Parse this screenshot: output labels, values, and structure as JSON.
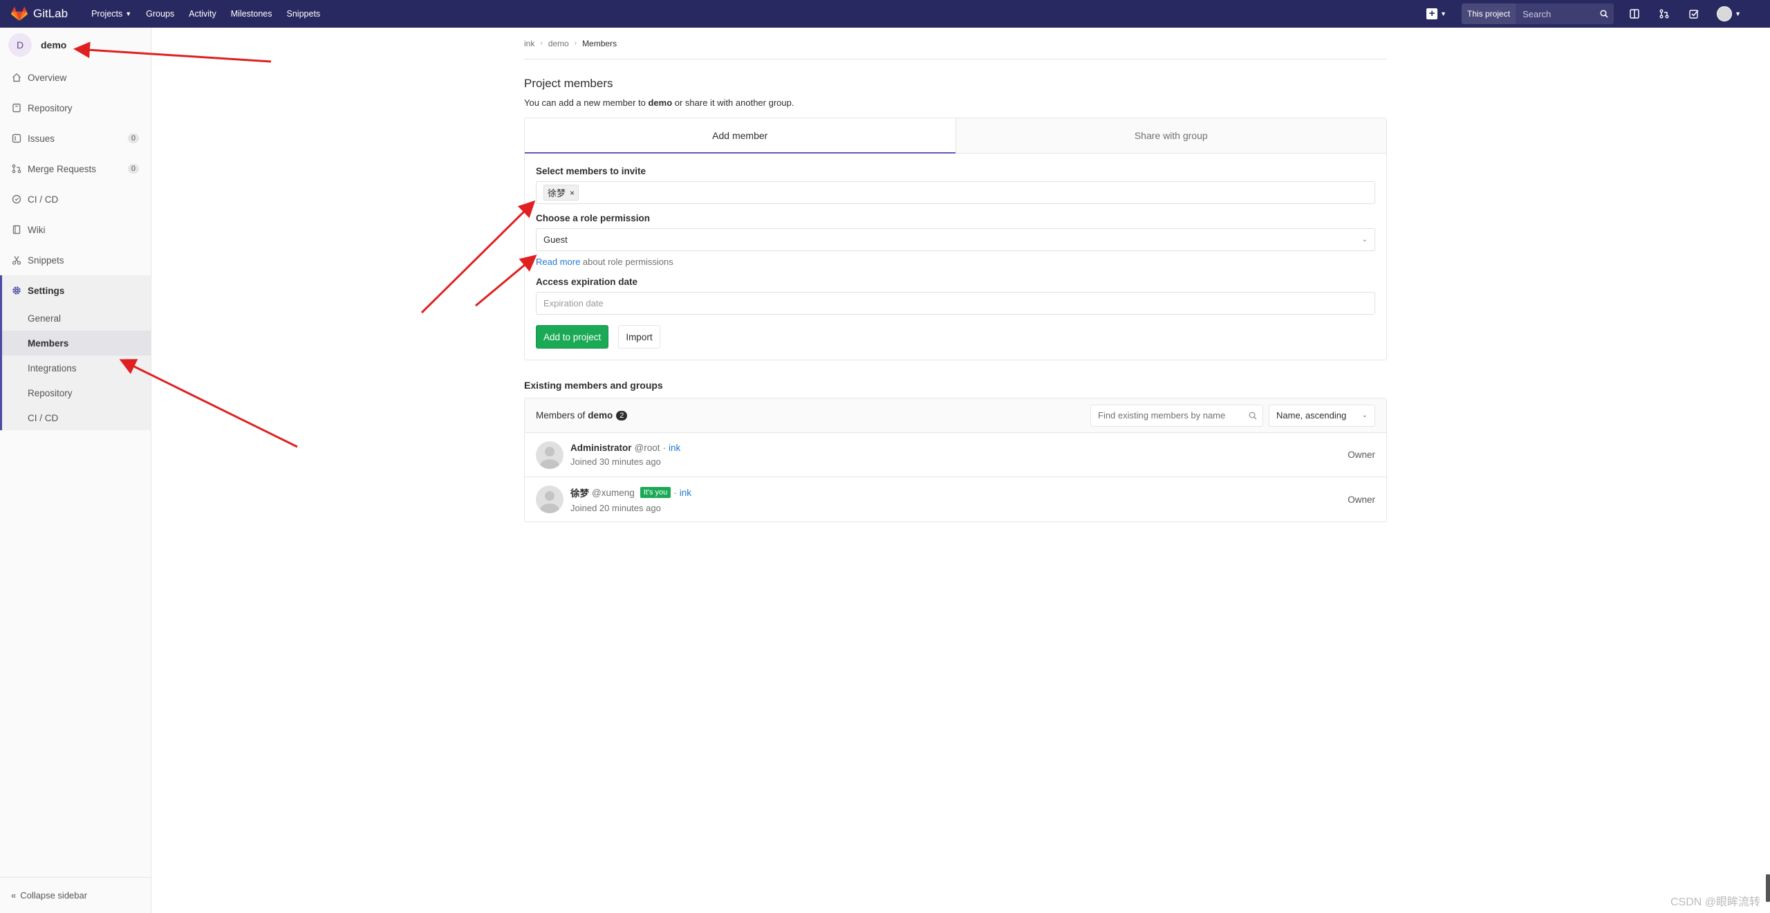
{
  "navbar": {
    "brand": "GitLab",
    "links": [
      {
        "label": "Projects",
        "has_caret": true
      },
      {
        "label": "Groups"
      },
      {
        "label": "Activity"
      },
      {
        "label": "Milestones"
      },
      {
        "label": "Snippets"
      }
    ],
    "search_scope": "This project",
    "search_placeholder": "Search"
  },
  "sidebar": {
    "project_initial": "D",
    "project_name": "demo",
    "items": [
      {
        "label": "Overview",
        "icon": "home-icon"
      },
      {
        "label": "Repository",
        "icon": "book-icon"
      },
      {
        "label": "Issues",
        "icon": "issues-icon",
        "badge": "0"
      },
      {
        "label": "Merge Requests",
        "icon": "merge-request-icon",
        "badge": "0"
      },
      {
        "label": "CI / CD",
        "icon": "rocket-icon"
      },
      {
        "label": "Wiki",
        "icon": "wiki-icon"
      },
      {
        "label": "Snippets",
        "icon": "scissors-icon"
      }
    ],
    "settings_label": "Settings",
    "settings_sub": [
      "General",
      "Members",
      "Integrations",
      "Repository",
      "CI / CD"
    ],
    "active_sub": "Members",
    "collapse_label": "Collapse sidebar"
  },
  "breadcrumb": [
    "ink",
    "demo",
    "Members"
  ],
  "page": {
    "title": "Project members",
    "desc_prefix": "You can add a new member to ",
    "desc_project": "demo",
    "desc_suffix": " or share it with another group."
  },
  "tabs": {
    "add": "Add member",
    "share": "Share with group"
  },
  "form": {
    "select_label": "Select members to invite",
    "selected_token": "徐梦",
    "role_label": "Choose a role permission",
    "role_value": "Guest",
    "read_more": "Read more",
    "read_more_suffix": " about role permissions",
    "expiry_label": "Access expiration date",
    "expiry_placeholder": "Expiration date",
    "add_button": "Add to project",
    "import_button": "Import"
  },
  "existing": {
    "section_title": "Existing members and groups",
    "members_of": "Members of",
    "project": "demo",
    "count": "2",
    "find_placeholder": "Find existing members by name",
    "sort": "Name, ascending",
    "members": [
      {
        "name": "Administrator",
        "username": "@root",
        "source": "ink",
        "joined": "Joined 30 minutes ago",
        "role": "Owner",
        "is_you": false
      },
      {
        "name": "徐梦",
        "username": "@xumeng",
        "source": "ink",
        "joined": "Joined 20 minutes ago",
        "role": "Owner",
        "is_you": true,
        "you_label": "It's you"
      }
    ]
  },
  "watermark": "CSDN @眼眸流转",
  "colors": {
    "navbar": "#292961",
    "accent_tab": "#6b4fbb",
    "green": "#1aaa55",
    "link": "#1f78d1",
    "annotation_arrow": "#e02020"
  }
}
